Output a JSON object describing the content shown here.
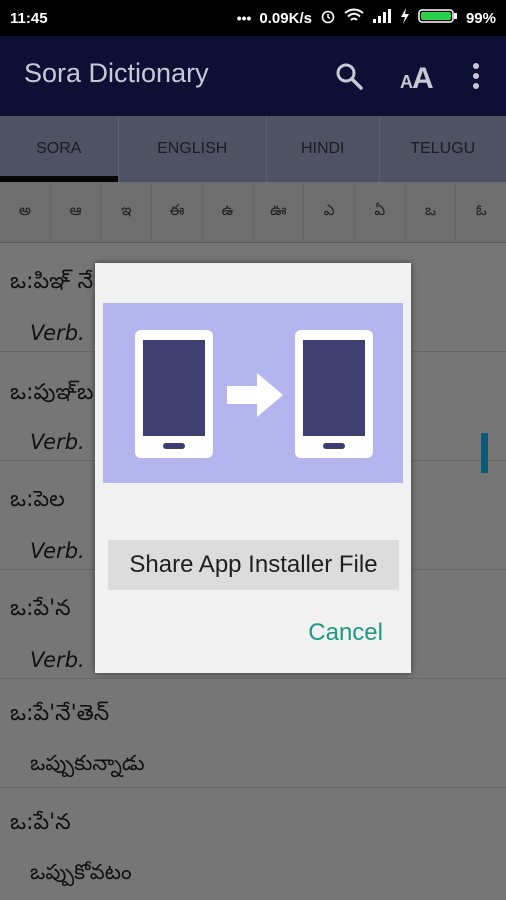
{
  "status_bar": {
    "time": "11:45",
    "network_speed": "0.09K/s",
    "battery": "99%"
  },
  "app_bar": {
    "title": "Sora Dictionary",
    "icons": [
      "search-icon",
      "text-size-icon",
      "overflow-menu-icon"
    ]
  },
  "tabs": [
    {
      "label": "SORA",
      "active": true
    },
    {
      "label": "ENGLISH",
      "active": false
    },
    {
      "label": "HINDI",
      "active": false
    },
    {
      "label": "TELUGU",
      "active": false
    }
  ],
  "letters": [
    "అ",
    "ఆ",
    "ఇ",
    "ఈ",
    "ఉ",
    "ఊ",
    "ఎ",
    "ఏ",
    "ఒ",
    "ఓ"
  ],
  "entries": [
    {
      "word": "ఒ:పిఞ్ నే",
      "meaning": "Verb."
    },
    {
      "word": "ఒ:పుఞ్‌బ",
      "meaning": "Verb."
    },
    {
      "word": "ఒ:పెల",
      "meaning": "Verb."
    },
    {
      "word": "ఒ:పే'న",
      "meaning": "Verb."
    },
    {
      "word": "ఒ:పే'నే'తెన్",
      "meaning": "ఒప్పుకున్నాడు"
    },
    {
      "word": "ఒ:పే'న",
      "meaning": "ఒప్పుకోవటం"
    }
  ],
  "dialog": {
    "share_label": "Share App Installer File",
    "cancel_label": "Cancel"
  },
  "colors": {
    "app_bar": "#0d0f35",
    "accent": "#1c9985",
    "banner": "#b4b5ef"
  }
}
